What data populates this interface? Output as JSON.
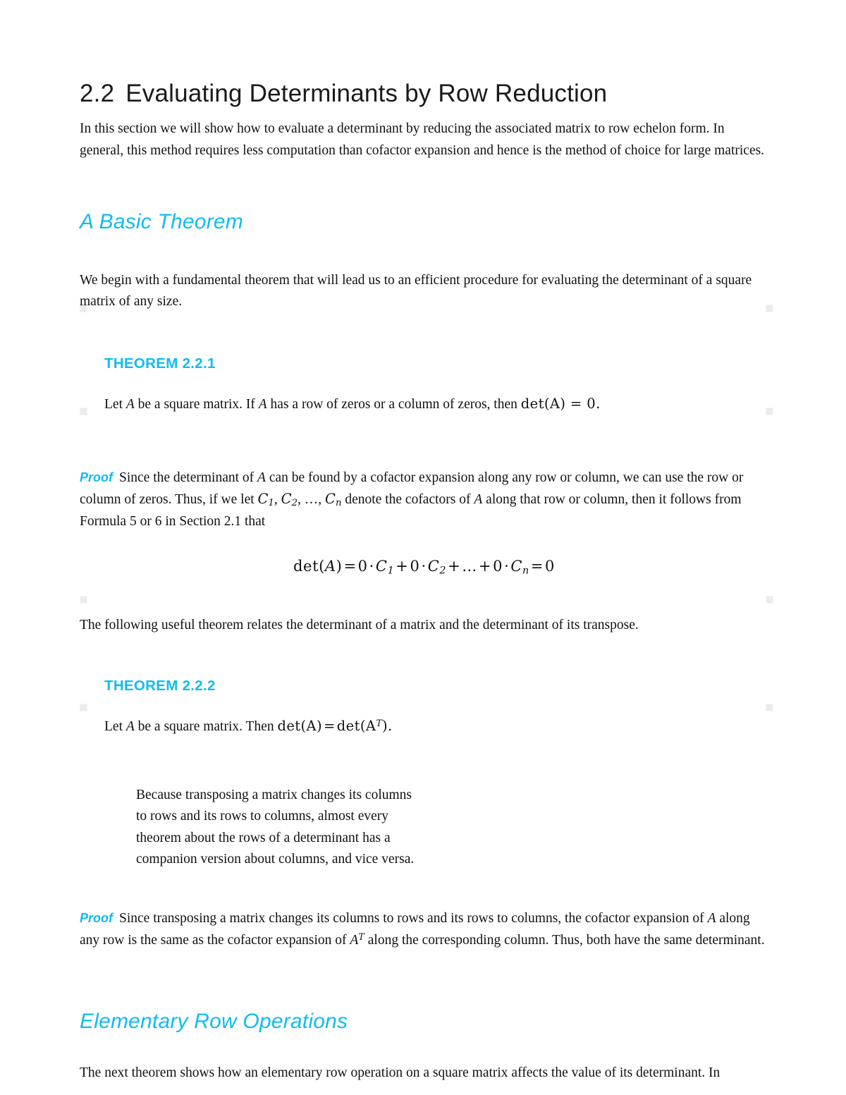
{
  "document": {
    "accent_color": "#0FBCF0",
    "text_color": "#111111",
    "background": "#FFFFFF",
    "title": {
      "number": "2.2",
      "text": "Evaluating Determinants by Row Reduction"
    },
    "intro_paragraph": "In this section we will show how to evaluate a determinant by reducing the associated matrix to row echelon form. In general, this method requires less computation than cofactor expansion and hence is the method of choice for large matrices.",
    "sections": [
      {
        "heading": "A Basic Theorem",
        "lead_paragraph": "We begin with a fundamental theorem that will lead us to an efficient procedure for evaluating the determinant of a square matrix of any size."
      },
      {
        "heading": "Elementary Row Operations",
        "lead_paragraph": "The next theorem shows how an elementary row operation on a square matrix affects the value of its determinant. In"
      }
    ],
    "theorems": [
      {
        "label": "THEOREM 2.2.1",
        "statement_prefix": "Let ",
        "statement_var": "A",
        "statement_mid": " be a square matrix. If ",
        "statement_var2": "A",
        "statement_suffix": " has a row of zeros or a column of zeros, then ",
        "statement_math": "det(A) = 0."
      },
      {
        "label": "THEOREM 2.2.2",
        "statement_prefix": "Let ",
        "statement_var": "A",
        "statement_mid": " be a square matrix. Then ",
        "statement_math_left": "det(A)",
        "statement_math_eq": "=",
        "statement_math_right_pre": "det(A",
        "statement_math_right_sup": "T",
        "statement_math_right_post": ")."
      }
    ],
    "proofs": [
      {
        "label": "Proof",
        "part1": "Since the determinant of ",
        "var1": "A",
        "part2": " can be found by a cofactor expansion along any row or column, we can use the row or column of zeros. Thus, if we let ",
        "cofactor1": "C",
        "cofactor1_sub": "1",
        "cofactor_sep1": ", ",
        "cofactor2": "C",
        "cofactor2_sub": "2",
        "cofactor_sep2": ", …, ",
        "cofactorn": "C",
        "cofactorn_sub": "n",
        "part3": " denote the cofactors of ",
        "var2": "A",
        "part4": " along that row or column, then it follows from Formula 5 or 6 in Section 2.1 that"
      },
      {
        "label": "Proof",
        "part1": "Since transposing a matrix changes its columns to rows and its rows to columns, the cofactor expansion of ",
        "var1": "A",
        "part2": " along any row is the same as the cofactor expansion of ",
        "var2": "A",
        "var2_sup": "T",
        "part3": " along the corresponding column. Thus, both have the same determinant."
      }
    ],
    "display_equation": {
      "det_open": "det(",
      "det_var": "A",
      "det_close": ")",
      "eq1": "=",
      "term1_zero": "0",
      "dot1": "·",
      "term1_c": "C",
      "term1_sub": "1",
      "plus1": "+",
      "term2_zero": "0",
      "dot2": "·",
      "term2_c": "C",
      "term2_sub": "2",
      "plus2": "+",
      "ellipsis": "…",
      "plus3": "+",
      "term3_zero": "0",
      "dot3": "·",
      "term3_c": "C",
      "term3_sub": "n",
      "eq2": "=",
      "result": "0"
    },
    "transition_paragraph": "The following useful theorem relates the determinant of a matrix and the determinant of its transpose.",
    "side_note": "Because transposing a matrix changes its columns to rows and its rows to columns, almost every theorem about the rows of a determinant has a companion version about columns, and vice versa."
  }
}
